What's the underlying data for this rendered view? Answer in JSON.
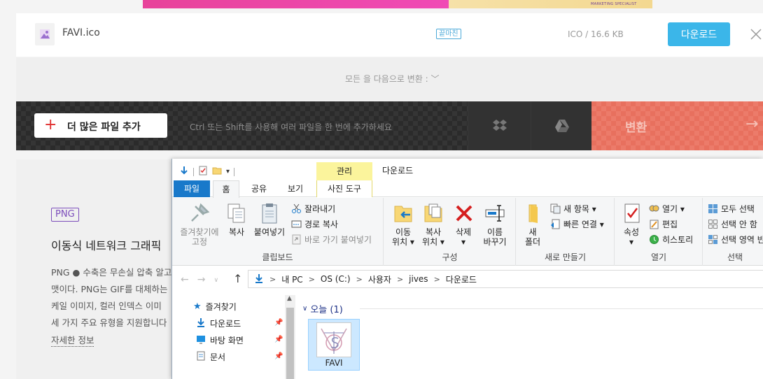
{
  "banner": {
    "tagline": "MARKETING SPECIALIST"
  },
  "file_card": {
    "name": "FAVI.ico",
    "status": "끝마친",
    "meta": "ICO / 16.6 KB",
    "download_label": "다운로드"
  },
  "convert_all": {
    "label": "모든 을 다음으로 변환 :"
  },
  "action_bar": {
    "add_files_label": "더 많은 파일 추가",
    "hint": "Ctrl 또는 Shift를 사용해 여러 파일을 한 번에 추가하세요",
    "convert_label": "변환"
  },
  "info": {
    "badge": "PNG",
    "title": "이동식 네트워크 그래픽",
    "desc": [
      "PNG ● 수축은 무손실 압축 알고",
      "맷이다. PNG는 GIF를 대체하는",
      "케일 이미지, 컬러 인덱스 이미",
      "세 가지 주요 유형을 지원합니다"
    ],
    "more": "자세한 정보"
  },
  "explorer": {
    "window_title": "다운로드",
    "context_tab": "관리",
    "tabs": {
      "file": "파일",
      "home": "홈",
      "share": "공유",
      "view": "보기",
      "photo": "사진 도구"
    },
    "ribbon": {
      "clipboard": {
        "label": "클립보드",
        "pin": [
          "즐겨찾기에",
          "고정"
        ],
        "copy": "복사",
        "paste": "붙여넣기",
        "cut": "잘라내기",
        "copy_path": "경로 복사",
        "paste_shortcut": "바로 가기 붙여넣기"
      },
      "organize": {
        "label": "구성",
        "move": [
          "이동",
          "위치 ▾"
        ],
        "copyto": [
          "복사",
          "위치 ▾"
        ],
        "delete": [
          "삭제",
          "▾"
        ],
        "rename": [
          "이름",
          "바꾸기"
        ]
      },
      "new": {
        "label": "새로 만들기",
        "folder": [
          "새",
          "폴더"
        ],
        "new_item": "새 항목 ▾",
        "easy_access": "빠른 연결 ▾"
      },
      "open": {
        "label": "열기",
        "properties": [
          "속성",
          "▾"
        ],
        "open": "열기 ▾",
        "edit": "편집",
        "history": "히스토리"
      },
      "select": {
        "label": "선택",
        "all": "모두 선택",
        "none": "선택 안 함",
        "invert": "선택 영역 반"
      }
    },
    "address": [
      "내 PC",
      "OS (C:)",
      "사용자",
      "jives",
      "다운로드"
    ],
    "nav": {
      "quick_access": "즐겨찾기",
      "downloads": "다운로드",
      "desktop": "바탕 화면",
      "documents": "문서"
    },
    "content": {
      "group": "오늘 (1)",
      "file_name": "FAVI"
    }
  }
}
